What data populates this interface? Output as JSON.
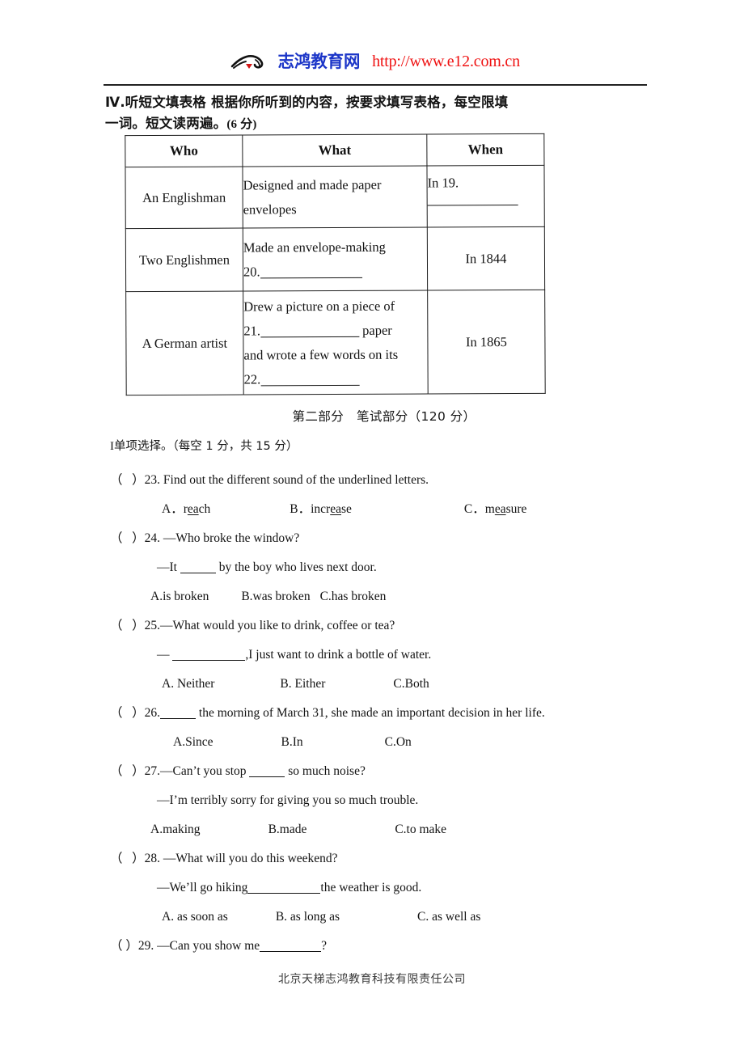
{
  "header": {
    "logo_icon": "zhihong-brush-logo",
    "brand_cn": "志鸿教育网",
    "url": "http://www.e12.com.cn",
    "brand_color": "#1b35c8",
    "url_color": "#ef1111"
  },
  "instruction": {
    "line1": "Ⅳ.听短文填表格  根据你所听到的内容，按要求填写表格，每空限填",
    "line2": "一词。短文读两遍。",
    "points": "(6 分)"
  },
  "listening_table": {
    "headers": [
      "Who",
      "What",
      "When"
    ],
    "rows": [
      {
        "who": "An Englishman",
        "what_line1": "Designed and made paper",
        "what_line2": "envelopes",
        "what_blank_no": "",
        "when_prefix": "In 19.",
        "when_has_blank": "yes",
        "when": ""
      },
      {
        "who": "Two Englishmen",
        "what_line1": "Made an envelope-making",
        "what_line2": "20.",
        "when_prefix": "",
        "when": "In 1844"
      },
      {
        "who": "A German artist",
        "what_line1": "Drew a picture on a piece of",
        "what_line2": "21.",
        "what_line2_tail": "paper",
        "what_line3": "and wrote a few words on its",
        "what_line4": "22.",
        "when_prefix": "",
        "when": "In 1865"
      }
    ]
  },
  "part_title": "第二部分　笔试部分（120 分）",
  "section": {
    "roman": "I",
    "label": "单项选择。（每空 1 分，共 15 分）"
  },
  "questions": [
    {
      "number": "23",
      "stem": "23. Find out the different sound of the underlined letters.",
      "options": [
        {
          "label": "A．",
          "pre": "r",
          "mid": "ea",
          "post": "ch"
        },
        {
          "label": "B．",
          "pre": "incr",
          "mid": "ea",
          "post": "se"
        },
        {
          "label": "C．",
          "pre": "m",
          "mid": "ea",
          "post": "sure"
        }
      ]
    },
    {
      "number": "24",
      "stem": "24. —Who broke the window?",
      "continuation_pre": "—It",
      "continuation_post": "by the boy who lives next door.",
      "options": [
        {
          "label": "A.is broken"
        },
        {
          "label": "B.was broken"
        },
        {
          "label": "C.has broken"
        }
      ]
    },
    {
      "number": "25",
      "stem": "25.—What would you like to drink, coffee or tea?",
      "continuation_pre": "—",
      "continuation_post": ",I just want to drink a bottle of water.",
      "options": [
        {
          "label": "A. Neither"
        },
        {
          "label": "B. Either"
        },
        {
          "label": "C.Both"
        }
      ]
    },
    {
      "number": "26",
      "stem_pre": "26.",
      "stem_post": "the morning of March 31, she made an important decision in her life.",
      "options": [
        {
          "label": "A.Since"
        },
        {
          "label": "B.In"
        },
        {
          "label": "C.On"
        }
      ]
    },
    {
      "number": "27",
      "stem_pre": "27.—Can’t you stop",
      "stem_post": "so much noise?",
      "continuation": "—I’m terribly sorry for giving you so much trouble.",
      "options": [
        {
          "label": "A.making"
        },
        {
          "label": "B.made"
        },
        {
          "label": "C.to make"
        }
      ]
    },
    {
      "number": "28",
      "stem": "28. —What will you do this weekend?",
      "continuation_pre": "—We’ll go hiking",
      "continuation_post": "the weather is good.",
      "options": [
        {
          "label": "A. as soon as"
        },
        {
          "label": "B. as long as"
        },
        {
          "label": "C. as well as"
        }
      ]
    },
    {
      "number": "29",
      "stem_pre": "29. —Can you show me",
      "stem_post": "?"
    }
  ],
  "footer": "北京天梯志鸿教育科技有限责任公司"
}
